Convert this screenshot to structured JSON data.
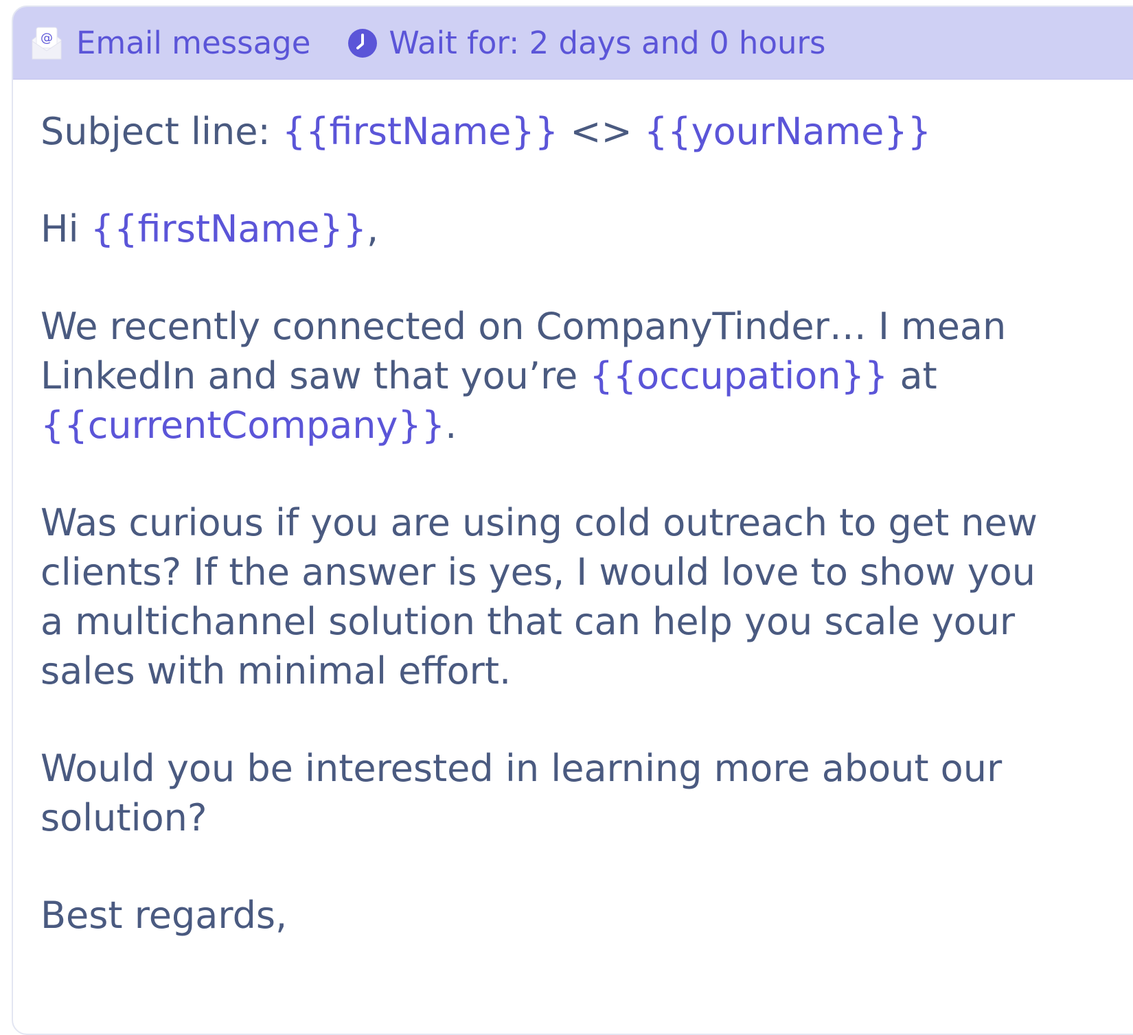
{
  "header": {
    "title": "Email message",
    "wait_label": "Wait for: 2 days and 0 hours"
  },
  "email": {
    "subject_prefix": "Subject line: ",
    "subject_var1": "{{firstName}}",
    "subject_sep": " <> ",
    "subject_var2": "{{yourName}}",
    "greeting_prefix": "Hi ",
    "greeting_var": "{{firstName}}",
    "greeting_suffix": ",",
    "p1_line1": "We recently connected on CompanyTinder… I mean",
    "p1_line2_prefix": "LinkedIn and saw that you’re ",
    "p1_var_occupation": "{{occupation}}",
    "p1_at": " at",
    "p1_var_company": "{{currentCompany}}",
    "p1_end": ".",
    "p2_line1": "Was curious if you are using cold outreach to get new",
    "p2_line2": "clients? If the answer is yes, I would love to show you",
    "p2_line3": "a multichannel solution that can help you scale your",
    "p2_line4": "sales with minimal effort.",
    "p3_line1": "Would you be interested in learning more about our",
    "p3_line2": "solution?",
    "signoff": "Best regards,"
  },
  "colors": {
    "header_bg": "#cfd0f4",
    "accent": "#5b55d8",
    "body_text": "#4a5a80"
  },
  "icons": {
    "mail": "email-envelope-icon",
    "clock": "clock-icon"
  }
}
